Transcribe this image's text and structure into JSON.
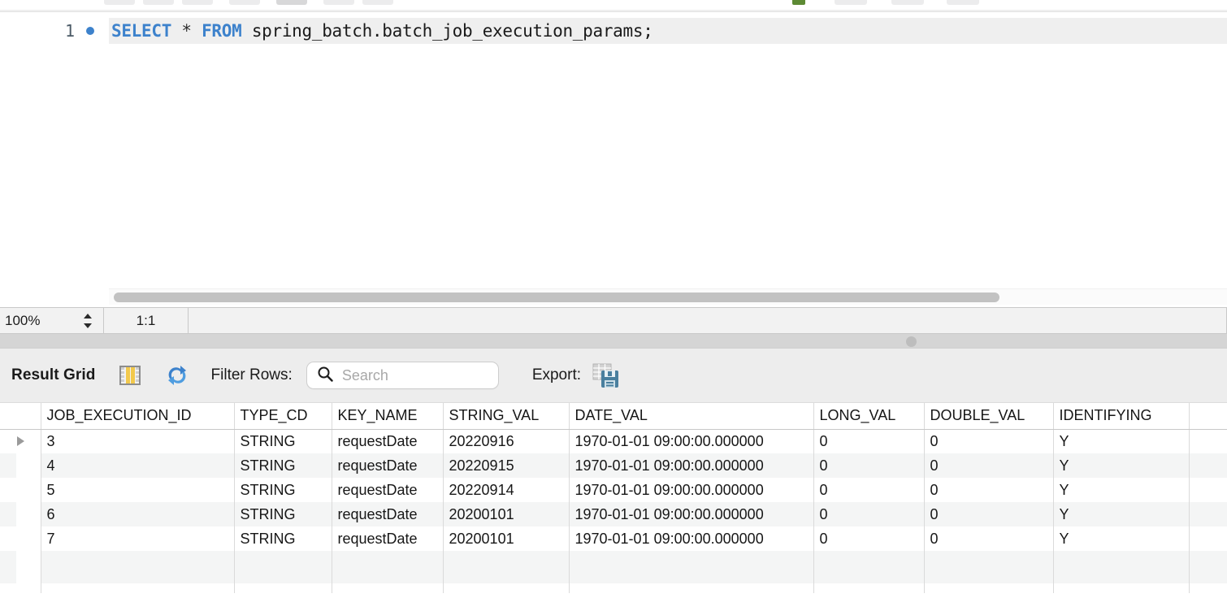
{
  "app": {
    "name": "MySQL Workbench SQL Editor"
  },
  "editor": {
    "line_number": "1",
    "breakpoint_icon": "blue-dot-icon",
    "sql": {
      "keyword_select": "SELECT",
      "star": "*",
      "keyword_from": "FROM",
      "table_reference": "spring_batch.batch_job_execution_params;"
    },
    "full_text": "SELECT * FROM spring_batch.batch_job_execution_params;"
  },
  "statusbar": {
    "zoom": "100%",
    "stepper_icon": "stepper-up-down-icon",
    "ratio": "1:1"
  },
  "splitter": {
    "grip_icon": "splitter-grip-icon"
  },
  "result_toolbar": {
    "title": "Result Grid",
    "grid_view_icon": "grid-view-icon",
    "refresh_icon": "refresh-icon",
    "filter_label": "Filter Rows:",
    "search_icon": "search-icon",
    "search_value": "",
    "search_placeholder": "Search",
    "export_label": "Export:",
    "export_icon": "export-save-icon"
  },
  "result_grid": {
    "columns": [
      "JOB_EXECUTION_ID",
      "TYPE_CD",
      "KEY_NAME",
      "STRING_VAL",
      "DATE_VAL",
      "LONG_VAL",
      "DOUBLE_VAL",
      "IDENTIFYING"
    ],
    "current_row_marker_icon": "row-pointer-icon",
    "rows": [
      {
        "JOB_EXECUTION_ID": "3",
        "TYPE_CD": "STRING",
        "KEY_NAME": "requestDate",
        "STRING_VAL": "20220916",
        "DATE_VAL": "1970-01-01 09:00:00.000000",
        "LONG_VAL": "0",
        "DOUBLE_VAL": "0",
        "IDENTIFYING": "Y"
      },
      {
        "JOB_EXECUTION_ID": "4",
        "TYPE_CD": "STRING",
        "KEY_NAME": "requestDate",
        "STRING_VAL": "20220915",
        "DATE_VAL": "1970-01-01 09:00:00.000000",
        "LONG_VAL": "0",
        "DOUBLE_VAL": "0",
        "IDENTIFYING": "Y"
      },
      {
        "JOB_EXECUTION_ID": "5",
        "TYPE_CD": "STRING",
        "KEY_NAME": "requestDate",
        "STRING_VAL": "20220914",
        "DATE_VAL": "1970-01-01 09:00:00.000000",
        "LONG_VAL": "0",
        "DOUBLE_VAL": "0",
        "IDENTIFYING": "Y"
      },
      {
        "JOB_EXECUTION_ID": "6",
        "TYPE_CD": "STRING",
        "KEY_NAME": "requestDate",
        "STRING_VAL": "20200101",
        "DATE_VAL": "1970-01-01 09:00:00.000000",
        "LONG_VAL": "0",
        "DOUBLE_VAL": "0",
        "IDENTIFYING": "Y"
      },
      {
        "JOB_EXECUTION_ID": "7",
        "TYPE_CD": "STRING",
        "KEY_NAME": "requestDate",
        "STRING_VAL": "20200101",
        "DATE_VAL": "1970-01-01 09:00:00.000000",
        "LONG_VAL": "0",
        "DOUBLE_VAL": "0",
        "IDENTIFYING": "Y"
      }
    ],
    "new_row_placeholder": {
      "JOB_EXECUTION_ID": "",
      "TYPE_CD": "",
      "KEY_NAME": "",
      "STRING_VAL": "",
      "DATE_VAL": "",
      "LONG_VAL": "",
      "DOUBLE_VAL": "",
      "IDENTIFYING": ""
    }
  },
  "colors": {
    "sql_keyword": "#3d82cc",
    "breakpoint_dot": "#3d82cc",
    "current_line_bg": "#efefef",
    "toolbar_bg": "#ededed",
    "row_alt_bg": "#f4f5f5",
    "splitter_bg": "#d5d5d5"
  }
}
